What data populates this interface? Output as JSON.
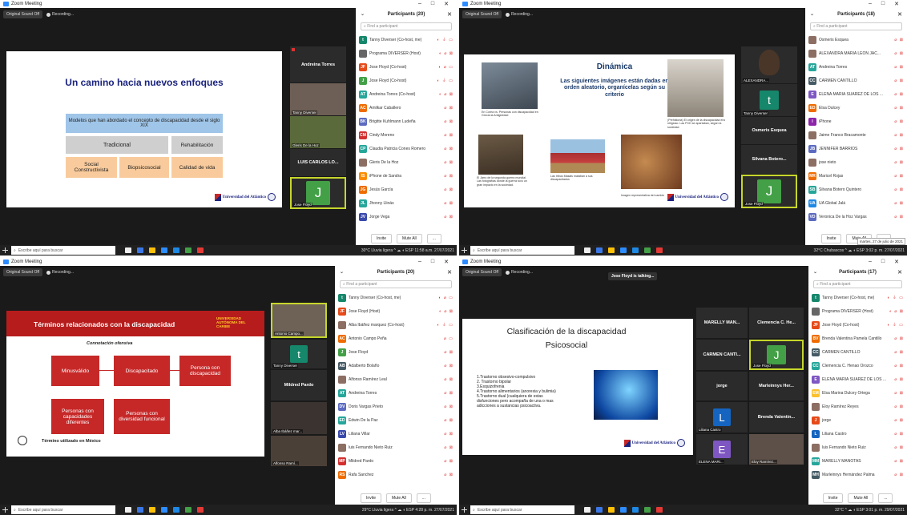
{
  "window_title": "Zoom Meeting",
  "window_controls": [
    "–",
    "□",
    "✕"
  ],
  "toolbar": {
    "sound": "Original Sound Off",
    "recording": "Recording..."
  },
  "panel_labels": {
    "search": "Find a participant",
    "invite": "Invite",
    "mute_all": "Mute All",
    "more": "..."
  },
  "taskbar": {
    "search": "Escribe aquí para buscar"
  },
  "icon_names": [
    "zoom-icon",
    "windows-start-icon",
    "search-icon",
    "mic-icon",
    "video-icon",
    "chevron-down-icon",
    "close-icon"
  ],
  "colors": {
    "accent": "#2d8cff",
    "muted_red": "#d33",
    "slide_red": "#c62828"
  },
  "q1": {
    "panel_title": "Participants (20)",
    "participants": [
      {
        "i": "t",
        "n": "Tanny Diverser (Co-host, me)",
        "c": "#16876b",
        "icons": "◐ ⏚ ▭"
      },
      {
        "i": "",
        "n": "Programa DIVERSER (Host)",
        "c": "#666",
        "icons": "◐ ⌀ ⊠"
      },
      {
        "i": "JF",
        "n": "Jose Floyd (Co-host)",
        "c": "#e64a19",
        "icons": "◐ ⌀ ▭"
      },
      {
        "i": "J",
        "n": "Jose Floyd (Co-host)",
        "c": "#43a047",
        "icons": "◐ ⏚ ▭"
      },
      {
        "i": "AT",
        "n": "Andreina Torres (Co-host)",
        "c": "#26a69a",
        "icons": "◐ ⌀ ⊠"
      },
      {
        "i": "AC",
        "n": "Amilkar Caballero",
        "c": "#ef6c00",
        "icons": "⌀ ⊠"
      },
      {
        "i": "BK",
        "n": "Brigitte Kuhlmann Ludeña",
        "c": "#5c6bc0",
        "icons": "⌀ ⊠"
      },
      {
        "i": "CM",
        "n": "Cindy Moreno",
        "c": "#d32f2f",
        "icons": "⌀ ⊠"
      },
      {
        "i": "CP",
        "n": "Claudia Patricia Cones Romero",
        "c": "#26a69a",
        "icons": "⌀ ⊠"
      },
      {
        "i": "",
        "n": "Gleris De la Hoz",
        "c": "#8d6e63",
        "icons": "⌀ ⊠"
      },
      {
        "i": "IS",
        "n": "iPhone de Sandra",
        "c": "#fb8c00",
        "icons": "⌀ ⊠"
      },
      {
        "i": "JG",
        "n": "Jesús García",
        "c": "#ef6c00",
        "icons": "⌀ ⊠"
      },
      {
        "i": "JL",
        "n": "Jhonny Llinás",
        "c": "#26a69a",
        "icons": "⌀ ⊠"
      },
      {
        "i": "JV",
        "n": "Jorge Vega",
        "c": "#3949ab",
        "icons": "⌀ ⊠"
      }
    ],
    "slide": {
      "title": "Un camino hacia nuevos enfoques",
      "subtitle": "Modelos que han abordado el concepto de discapacidad desde el siglo XIX",
      "trad": "Tradicional",
      "rehab": "Rehabilitación",
      "social": "Social Constructivista",
      "bio": "Biopsicosocial",
      "calidad": "Calidad de vida",
      "logo": "Universidad del Atlántico"
    },
    "tiles": {
      "a": "Andreina Torres",
      "b": "Tanny Diverser",
      "c": "Gleris De la Hoz",
      "d": "LUIS CARLOS LO...",
      "e": "Jose Floyd",
      "e_av": "J"
    },
    "tray": "30°C Lluvia ligera ^ ☁ ◖ ESP 11:58 a.m. 27/07/2021"
  },
  "q2": {
    "panel_title": "Participants (18)",
    "participants": [
      {
        "i": "",
        "n": "Osmeris Esquea",
        "c": "#8d6e63",
        "icons": "⌀ ⊠"
      },
      {
        "i": "",
        "n": "ALEXANDRA MARIA LEON JAC...",
        "c": "#8d6e63",
        "icons": "⌀ ⊠"
      },
      {
        "i": "AT",
        "n": "Andreina Torres",
        "c": "#26a69a",
        "icons": "⌀ ⊠"
      },
      {
        "i": "CC",
        "n": "CARMEN CANTILLO",
        "c": "#455a64",
        "icons": "⌀ ⊠"
      },
      {
        "i": "E",
        "n": "ELENA MARIA SUAREZ DE LOS ...",
        "c": "#7e57c2",
        "icons": "⌀ ⊠"
      },
      {
        "i": "ED",
        "n": "Elsa Dulcey",
        "c": "#ef6c00",
        "icons": "⌀ ⊠"
      },
      {
        "i": "I",
        "n": "iPhone",
        "c": "#8e24aa",
        "icons": "⌀ ⊠"
      },
      {
        "i": "",
        "n": "Jaime Franco Bracamonte",
        "c": "#8d6e63",
        "icons": "⌀ ⊠"
      },
      {
        "i": "JB",
        "n": "JENNIFER BARRIOS",
        "c": "#5c6bc0",
        "icons": "⌀ ⊠"
      },
      {
        "i": "",
        "n": "jose nieto",
        "c": "#8d6e63",
        "icons": "⌀ ⊠"
      },
      {
        "i": "MR",
        "n": "Maricel Rojas",
        "c": "#ef6c00",
        "icons": "⌀ ⊠"
      },
      {
        "i": "SB",
        "n": "Silvana Botero Quintero",
        "c": "#26a69a",
        "icons": "⌀ ⊠"
      },
      {
        "i": "UA",
        "n": "UA Global Jalá",
        "c": "#1e88e5",
        "icons": "⌀ ⊠"
      },
      {
        "i": "VD",
        "n": "Veronica De la Hoz Vargas",
        "c": "#5c6bc0",
        "icons": "⌀ ⊠"
      }
    ],
    "slide": {
      "title": "Dinámica",
      "body": "Las siguientes imágenes están dadas en orden aleatorio, organícelas según su criterio",
      "cap1": "En Corea vs. Personas con discapacidad en Grecia la Antigüedad",
      "cap2": "(Prehistoria) El origen de la discapacidad era religioso. Las PCD se apartaban, según la sociedad.",
      "cap3": "El Jarro de la segunda guerra mundial. Las fotografías donde la guerra tuvo un gran impacto en la sociedad.",
      "cap4": "Las tribus Masáis mataban a sus discapacitados",
      "cap5": "Imagen representativa del cambio",
      "logo": "Universidad del Atlántico"
    },
    "tiles": {
      "a": "ALEXANDRA...",
      "b": "Tanny Diverser",
      "b_av": "t",
      "c": "Osmeris Esquea",
      "d": "Silvana Botero...",
      "e": "Jose Floyd",
      "e_av": "J"
    },
    "date_tip": "martes, 27 de julio de 2021",
    "tray": "32°C Chubascos ^ ☁ ◖ ESP 3:02 p. m. 27/07/2021"
  },
  "q3": {
    "panel_title": "Participants (20)",
    "participants": [
      {
        "i": "t",
        "n": "Tanny Diverser (Co-host, me)",
        "c": "#16876b",
        "icons": "◐ ⌀ ▭"
      },
      {
        "i": "JF",
        "n": "Jose Floyd (Host)",
        "c": "#e64a19",
        "icons": "◐ ⌀ ⊠"
      },
      {
        "i": "",
        "n": "Alba Ibáñez marquez (Co-host)",
        "c": "#8d6e63",
        "icons": "◐ ⏚ ▭"
      },
      {
        "i": "AC",
        "n": "Antonio Campo Peña",
        "c": "#ef6c00",
        "icons": "⌀ ▭"
      },
      {
        "i": "J",
        "n": "Jose Floyd",
        "c": "#43a047",
        "icons": "⌀ ⊠"
      },
      {
        "i": "AB",
        "n": "Adalberto Bolaño",
        "c": "#455a64",
        "icons": "⌀ ⊠"
      },
      {
        "i": "",
        "n": "Alfonso Ramírez Leal",
        "c": "#8d6e63",
        "icons": "⌀ ⊠"
      },
      {
        "i": "AT",
        "n": "Andreina Torres",
        "c": "#26a69a",
        "icons": "⌀ ⊠"
      },
      {
        "i": "DV",
        "n": "Doris Vargas Prieto",
        "c": "#5c6bc0",
        "icons": "⌀ ⊠"
      },
      {
        "i": "ED",
        "n": "Edwin De la Paz",
        "c": "#26a69a",
        "icons": "⌀ ⊠"
      },
      {
        "i": "LV",
        "n": "Liliana Villar",
        "c": "#3949ab",
        "icons": "⌀ ⊠"
      },
      {
        "i": "",
        "n": "luis Fernando Nieto Ruiz",
        "c": "#8d6e63",
        "icons": "⌀ ⊠"
      },
      {
        "i": "MP",
        "n": "Mildred Pardo",
        "c": "#d32f2f",
        "icons": "⌀ ⊠"
      },
      {
        "i": "RS",
        "n": "Rafa Sanchez",
        "c": "#ef6c00",
        "icons": "⌀ ⊠"
      }
    ],
    "slide": {
      "title": "Términos relacionados con la discapacidad",
      "univ": "UNIVERSIDAD AUTÓNOMA DEL CARIBE",
      "connot": "Connotación ofensiva",
      "b1": "Minusválido",
      "b2": "Discapacitado",
      "b3": "Persona con discapacidad",
      "b4": "Personas con capacidades diferentes",
      "b5": "Personas con diversidad funcional",
      "foot": "Término utilizado en México"
    },
    "tiles": {
      "a": "Antonio Campo...",
      "b": "Tanny Diverser",
      "b_av": "t",
      "c": "Mildred Pardo",
      "d": "Alba Ibáñez mar...",
      "e": "Alfonso Ramí..."
    },
    "tray": "29°C Lluvia ligera ^ ☁ ◖ ESP 4:28 p. m. 27/07/2021"
  },
  "q4": {
    "panel_title": "Participants (17)",
    "talking": "Jose Floyd is talking...",
    "participants": [
      {
        "i": "t",
        "n": "Tanny Diverser (Co-host, me)",
        "c": "#16876b",
        "icons": "◐ ⏚ ▭"
      },
      {
        "i": "",
        "n": "Programa DIVERSER (Host)",
        "c": "#666",
        "icons": "◐ ⌀ ⊠"
      },
      {
        "i": "JF",
        "n": "Jose Floyd (Co-host)",
        "c": "#e64a19",
        "icons": "◐ ⏚ ▭"
      },
      {
        "i": "BV",
        "n": "Brenda Valentina Pamela Cantillo",
        "c": "#ef6c00",
        "icons": "⌀ ⊠"
      },
      {
        "i": "CC",
        "n": "CARMEN CANTILLO",
        "c": "#455a64",
        "icons": "⌀ ⊠"
      },
      {
        "i": "CC",
        "n": "Clemencia C. Henao Orozco",
        "c": "#26a69a",
        "icons": "⌀ ⊠"
      },
      {
        "i": "E",
        "n": "ELENA MARIA SUAREZ DE LOS ...",
        "c": "#7e57c2",
        "icons": "⌀ ⊠"
      },
      {
        "i": "EM",
        "n": "Elsa Marina Dulcey Ortega",
        "c": "#fbc02d",
        "icons": "⌀ ⊠"
      },
      {
        "i": "",
        "n": "Eloy Ramírez Reyes",
        "c": "#8d6e63",
        "icons": "⌀ ⊠"
      },
      {
        "i": "J",
        "n": "jorge",
        "c": "#e64a19",
        "icons": "⌀ ⊠"
      },
      {
        "i": "L",
        "n": "Liliana Castro",
        "c": "#1565c0",
        "icons": "⌀ ⊠"
      },
      {
        "i": "",
        "n": "luis Fernando Nieto Ruiz",
        "c": "#8d6e63",
        "icons": "⌀ ⊠"
      },
      {
        "i": "MM",
        "n": "MARELLY MANOTAS",
        "c": "#26a69a",
        "icons": "⌀ ⊠"
      },
      {
        "i": "MH",
        "n": "Marleinnys Hernández Palma",
        "c": "#455a64",
        "icons": "⌀ ⊠"
      }
    ],
    "slide": {
      "title": "Clasificación de la discapacidad Psicosocial",
      "list": "1.Trastorno obsesivo-compulsivo\n2. Trastorno bipolar\n3.Esquizofrenia\n4.Trastorno alimentarios (anorexia y bulimia)\n5.Trastorno dual (cualquiera de estas disfunciones pero acompaña de una o mas adicciones a sustancias psicoactiva.",
      "logo": "Universidad del Atlántico"
    },
    "tiles": {
      "a": "MARELLY MAN...",
      "b": "Clemencia C. He...",
      "c": "CARMEN CANTI...",
      "d": "Jose Floyd",
      "d_av": "J",
      "e": "jorge",
      "f": "Marleinnys Her...",
      "g": "Liliana Castro",
      "g_av": "L",
      "h": "Brenda Valentin...",
      "i": "ELENA MARI...",
      "i_av": "E",
      "j": "Eloy Ramírez..."
    },
    "tray": "32°C ^ ☁ ◖ ESP 3:01 p. m. 29/07/2021"
  }
}
